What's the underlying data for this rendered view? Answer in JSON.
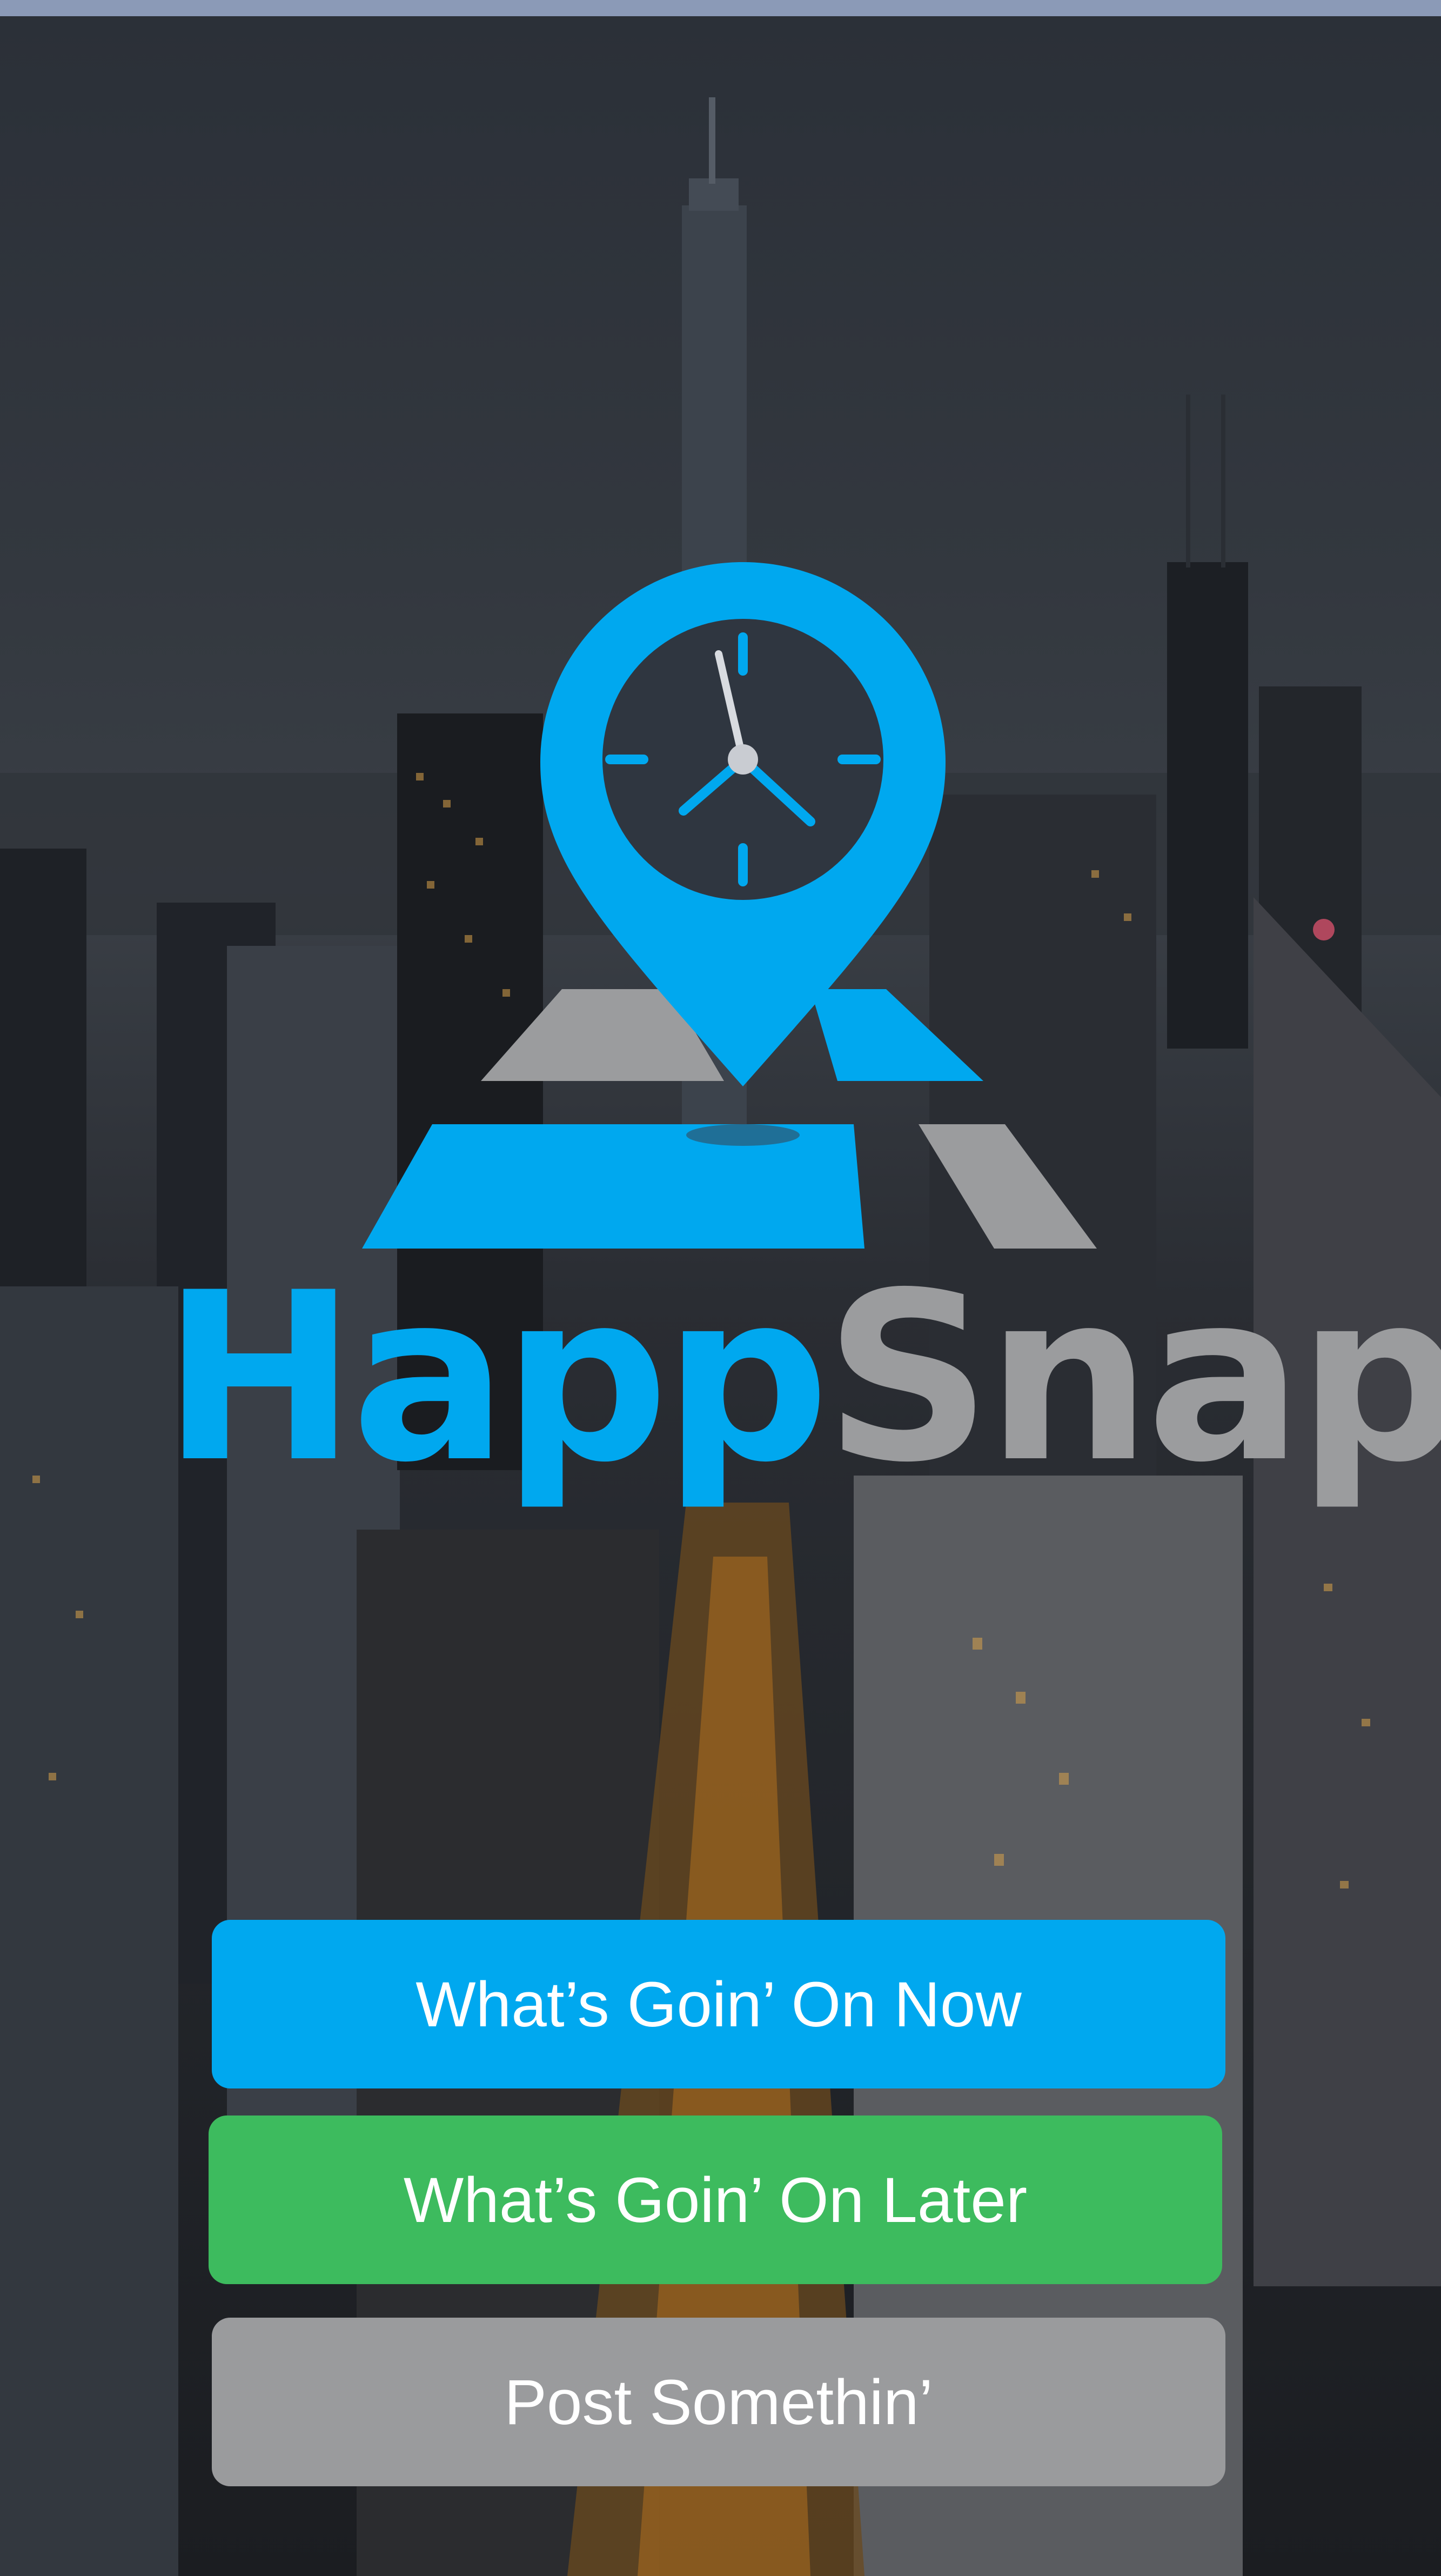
{
  "app": {
    "name_part_1": "Happ",
    "name_part_2": "Snap"
  },
  "colors": {
    "brand_blue": "#00a8ef",
    "brand_gray": "#9b9c9e",
    "later_green": "#3dbb5e",
    "post_gray": "#9a9b9d"
  },
  "icons": {
    "logo": "location-pin-clock-on-road-icon"
  },
  "actions": {
    "now_label": "What’s Goin’ On Now",
    "later_label": "What’s Goin’ On Later",
    "post_label": "Post Somethin’"
  }
}
